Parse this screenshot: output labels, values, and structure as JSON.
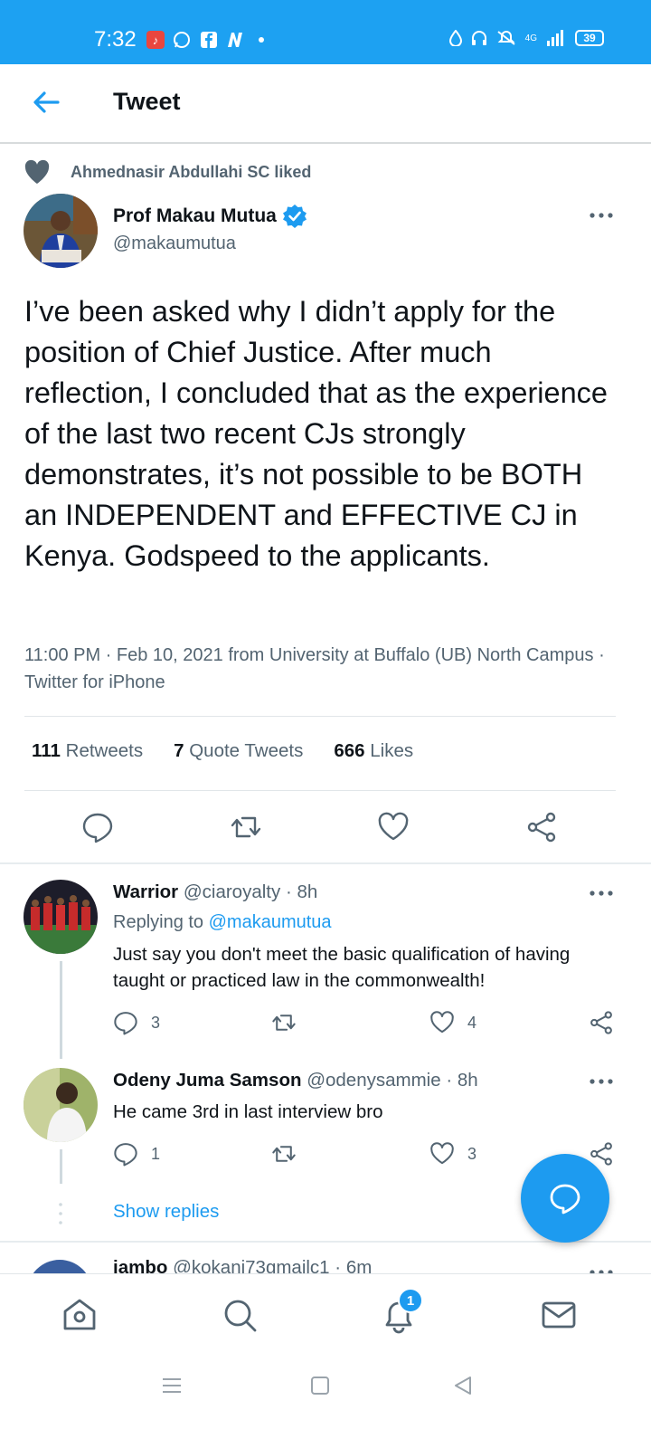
{
  "status_bar": {
    "time": "7:32",
    "network": "4G",
    "battery": "39",
    "left_icons": [
      "music-app-icon",
      "whatsapp-icon",
      "facebook-icon",
      "news-icon"
    ],
    "right_icons": [
      "drop-icon",
      "headset-icon",
      "mute-icon",
      "signal-icon"
    ]
  },
  "header": {
    "title": "Tweet",
    "back_icon": "back-arrow-icon"
  },
  "social_context": {
    "text": "Ahmednasir Abdullahi SC liked",
    "icon": "heart-filled-icon"
  },
  "tweet": {
    "author_name": "Prof Makau Mutua",
    "author_handle": "@makaumutua",
    "verified": true,
    "text": "I’ve been asked why I didn’t apply for the position of Chief Justice.  After much reflection, I concluded that as the experience of the last two recent CJs strongly demonstrates, it’s not possible to be BOTH an INDEPENDENT and EFFECTIVE CJ in Kenya.  Godspeed to the applicants.",
    "meta_time": "11:00 PM · Feb 10, 2021 from University at Buffalo (UB) North Campus · Twitter for iPhone",
    "stats": {
      "retweets_count": "111",
      "retweets_label": "Retweets",
      "quotes_count": "7",
      "quotes_label": "Quote Tweets",
      "likes_count": "666",
      "likes_label": "Likes"
    }
  },
  "replies": [
    {
      "name": "Warrior",
      "handle": "@ciaroyalty",
      "time": "· 8h",
      "replying_label": "Replying to",
      "replying_to": "@makaumutua",
      "text": "Just say you don't meet the basic qualification of having taught or practiced law in the commonwealth!",
      "reply_count": "3",
      "like_count": "4"
    },
    {
      "name": "Odeny Juma Samson",
      "handle": "@odenysammie",
      "time": "· 8h",
      "text": "He came 3rd in last interview bro",
      "reply_count": "1",
      "like_count": "3"
    }
  ],
  "show_replies": "Show replies",
  "partial_reply": {
    "name": "jambo",
    "handle": "@kokani73gmailc1",
    "time": "· 6m"
  },
  "bottom_nav": {
    "notifications_badge": "1",
    "items": [
      "home-icon",
      "search-icon",
      "notifications-icon",
      "messages-icon"
    ]
  },
  "colors": {
    "brand": "#1da1f2",
    "link": "#1d9bf0",
    "muted": "#536471",
    "text": "#0f1419"
  }
}
